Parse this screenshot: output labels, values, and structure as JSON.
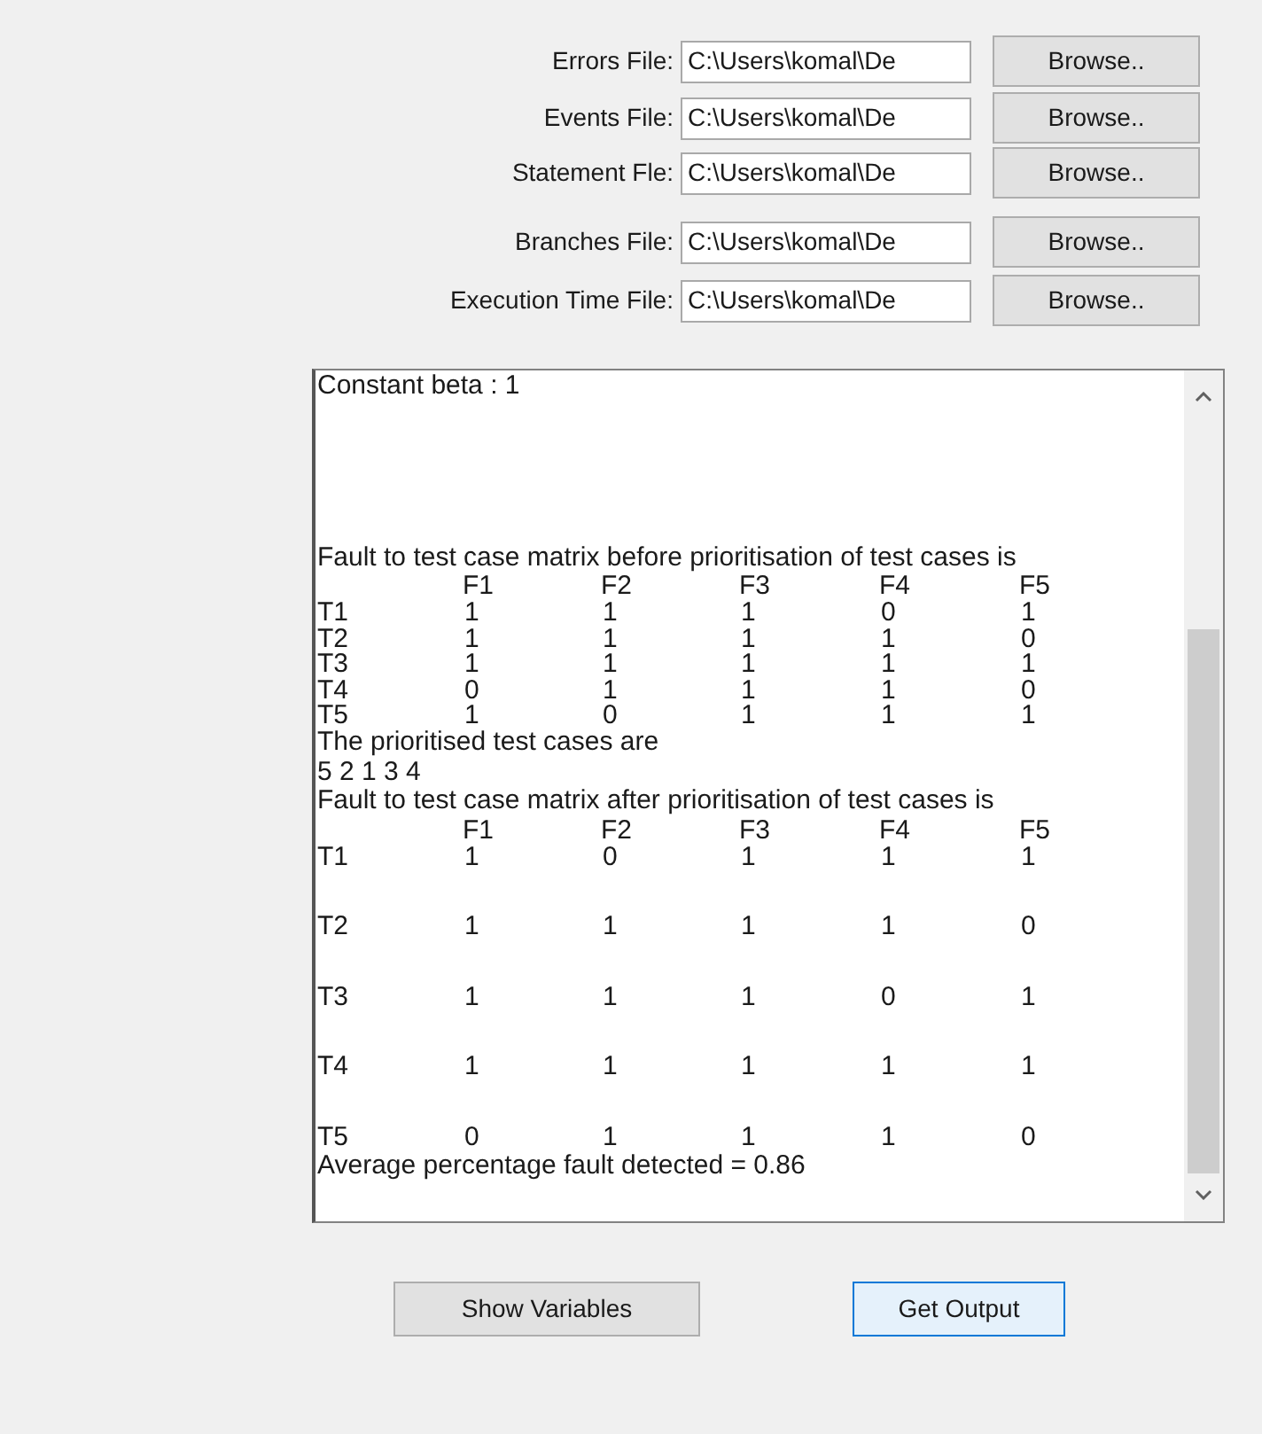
{
  "file_rows": [
    {
      "label": "Errors File:",
      "value": "C:\\Users\\komal\\De",
      "button": "Browse.."
    },
    {
      "label": "Events File:",
      "value": "C:\\Users\\komal\\De",
      "button": "Browse.."
    },
    {
      "label": "Statement Fle:",
      "value": "C:\\Users\\komal\\De",
      "button": "Browse.."
    },
    {
      "label": "Branches File:",
      "value": "C:\\Users\\komal\\De",
      "button": "Browse.."
    },
    {
      "label": "Execution Time File:",
      "value": "C:\\Users\\komal\\De",
      "button": "Browse.."
    }
  ],
  "output": {
    "blocks": [
      {
        "kind": "text",
        "text": "Constant beta : 1"
      },
      {
        "kind": "text",
        "text": "Fault to test case matrix before prioritisation of test cases is"
      },
      {
        "kind": "matrix",
        "double_spaced": false,
        "columns": [
          "F1",
          "F2",
          "F3",
          "F4",
          "F5"
        ],
        "rows": [
          {
            "label": "T1",
            "values": [
              "1",
              "1",
              "1",
              "0",
              "1"
            ]
          },
          {
            "label": "T2",
            "values": [
              "1",
              "1",
              "1",
              "1",
              "0"
            ]
          },
          {
            "label": "T3",
            "values": [
              "1",
              "1",
              "1",
              "1",
              "1"
            ]
          },
          {
            "label": "T4",
            "values": [
              "0",
              "1",
              "1",
              "1",
              "0"
            ]
          },
          {
            "label": "T5",
            "values": [
              "1",
              "0",
              "1",
              "1",
              "1"
            ]
          }
        ]
      },
      {
        "kind": "text",
        "text": "The prioritised test cases are"
      },
      {
        "kind": "text",
        "text": "5 2 1 3 4"
      },
      {
        "kind": "text",
        "text": "Fault to test case matrix after prioritisation of test cases is"
      },
      {
        "kind": "matrix",
        "double_spaced": true,
        "columns": [
          "F1",
          "F2",
          "F3",
          "F4",
          "F5"
        ],
        "rows": [
          {
            "label": "T1",
            "values": [
              "1",
              "0",
              "1",
              "1",
              "1"
            ]
          },
          {
            "label": "T2",
            "values": [
              "1",
              "1",
              "1",
              "1",
              "0"
            ]
          },
          {
            "label": "T3",
            "values": [
              "1",
              "1",
              "1",
              "0",
              "1"
            ]
          },
          {
            "label": "T4",
            "values": [
              "1",
              "1",
              "1",
              "1",
              "1"
            ]
          },
          {
            "label": "T5",
            "values": [
              "0",
              "1",
              "1",
              "1",
              "0"
            ]
          }
        ]
      },
      {
        "kind": "text",
        "text": "Average percentage fault detected =  0.86"
      }
    ]
  },
  "buttons": [
    {
      "label": "Show Variables",
      "focused": false
    },
    {
      "label": "Get Output",
      "focused": true
    }
  ]
}
